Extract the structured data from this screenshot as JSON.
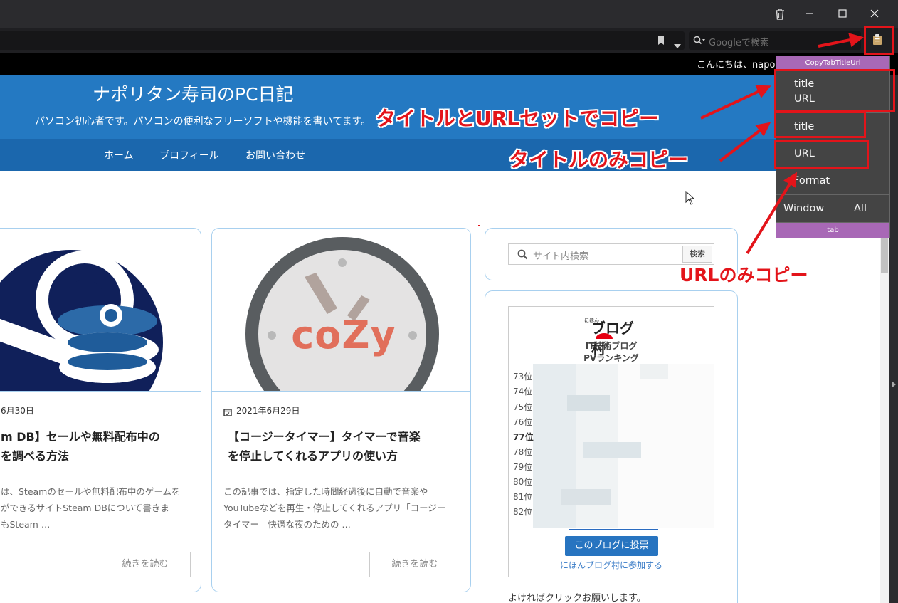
{
  "browser": {
    "search_placeholder": "Googleで検索",
    "greeting": "こんにちは、napor"
  },
  "site": {
    "title": "ナポリタン寿司のPC日記",
    "description": "パソコン初心者です。パソコンの便利なフリーソフトや機能を書いてます。",
    "nav": [
      "ホーム",
      "プロフィール",
      "お問い合わせ"
    ]
  },
  "posts": [
    {
      "date": "6月30日",
      "title_lines": [
        "m DB】セールや無料配布中の",
        "を調べる方法"
      ],
      "excerpt_lines": [
        "は、Steamのセールや無料配布中のゲームを",
        "ができるサイトSteam DBについて書きま",
        "もSteam …"
      ],
      "read_more": "続きを読む"
    },
    {
      "date": "2021年6月29日",
      "title_lines": [
        "【コージータイマー】タイマーで音楽",
        "を停止してくれるアプリの使い方"
      ],
      "excerpt_lines": [
        "この記事では、指定した時間経過後に自動で音楽や",
        "YouTubeなどを再生・停止してくれるアプリ「コージー",
        "タイマー - 快適な夜のための …"
      ],
      "read_more": "続きを読む"
    }
  ],
  "thumb_logo": "coZy",
  "sidebar": {
    "search_placeholder": "サイト内検索",
    "search_button": "検索",
    "widget_logo": "ブログ村",
    "widget_logo_small": "にほん",
    "widget_title_1": "IT技術ブログ",
    "widget_title_2": "PVランキング",
    "ranks": [
      "73位",
      "74位",
      "75位",
      "76位",
      "77位",
      "78位",
      "79位",
      "80位",
      "81位",
      "82位"
    ],
    "vote_button": "このブログに投票",
    "join_link": "にほんブログ村に参加する",
    "footer_text": "よければクリックお願いします。"
  },
  "popup": {
    "header": "CopyTabTitleUrl",
    "title_url_1": "title",
    "title_url_2": "URL",
    "title_only": "title",
    "url_only": "URL",
    "format": "Format",
    "window": "Window",
    "all": "All",
    "footer": "tab"
  },
  "annotations": {
    "title_and_url": "タイトルとURLセットでコピー",
    "title_only": "タイトルのみコピー",
    "url_only": "URLのみコピー"
  },
  "colors": {
    "annotation": "#e3141a",
    "header_blue": "#2479c2",
    "nav_blue": "#1b67ad",
    "popup_purple": "#a868b6"
  }
}
